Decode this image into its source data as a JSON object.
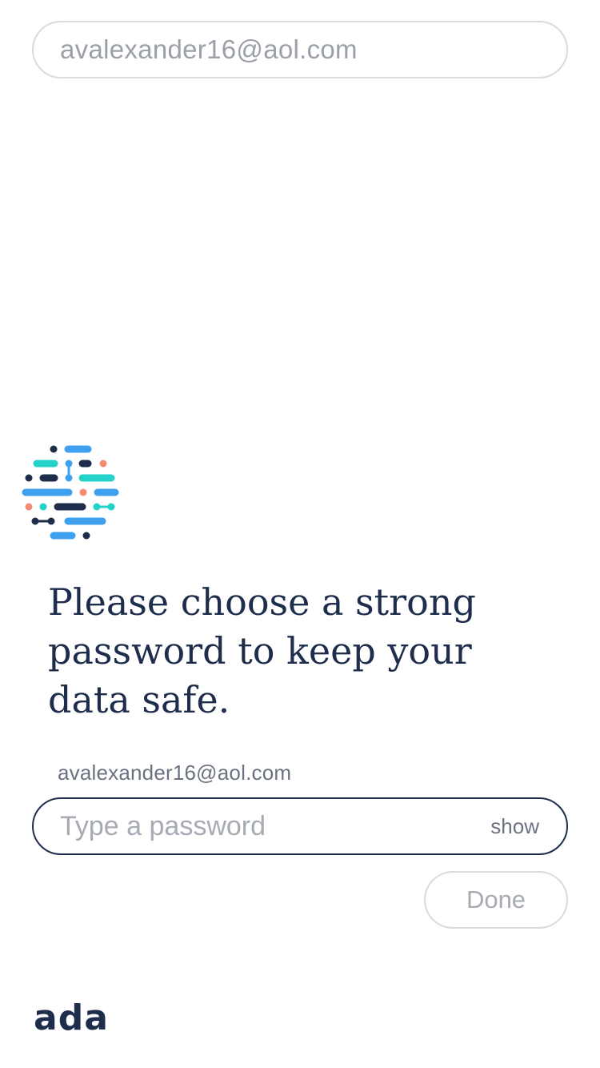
{
  "top_field": {
    "email": "avalexander16@aol.com"
  },
  "colors": {
    "navy": "#1f2d4d",
    "blue": "#3fa0f0",
    "teal": "#23d2c8",
    "coral": "#f48a72",
    "muted_border": "#d9dbdf"
  },
  "logo": {
    "icon": "ada-dots-icon"
  },
  "headline": "Please choose a strong password to keep your data safe.",
  "form": {
    "email_label": "avalexander16@aol.com",
    "password_placeholder": "Type a password",
    "password_value": "",
    "show_label": "show",
    "done_label": "Done"
  },
  "footer": {
    "brand": "ada"
  }
}
